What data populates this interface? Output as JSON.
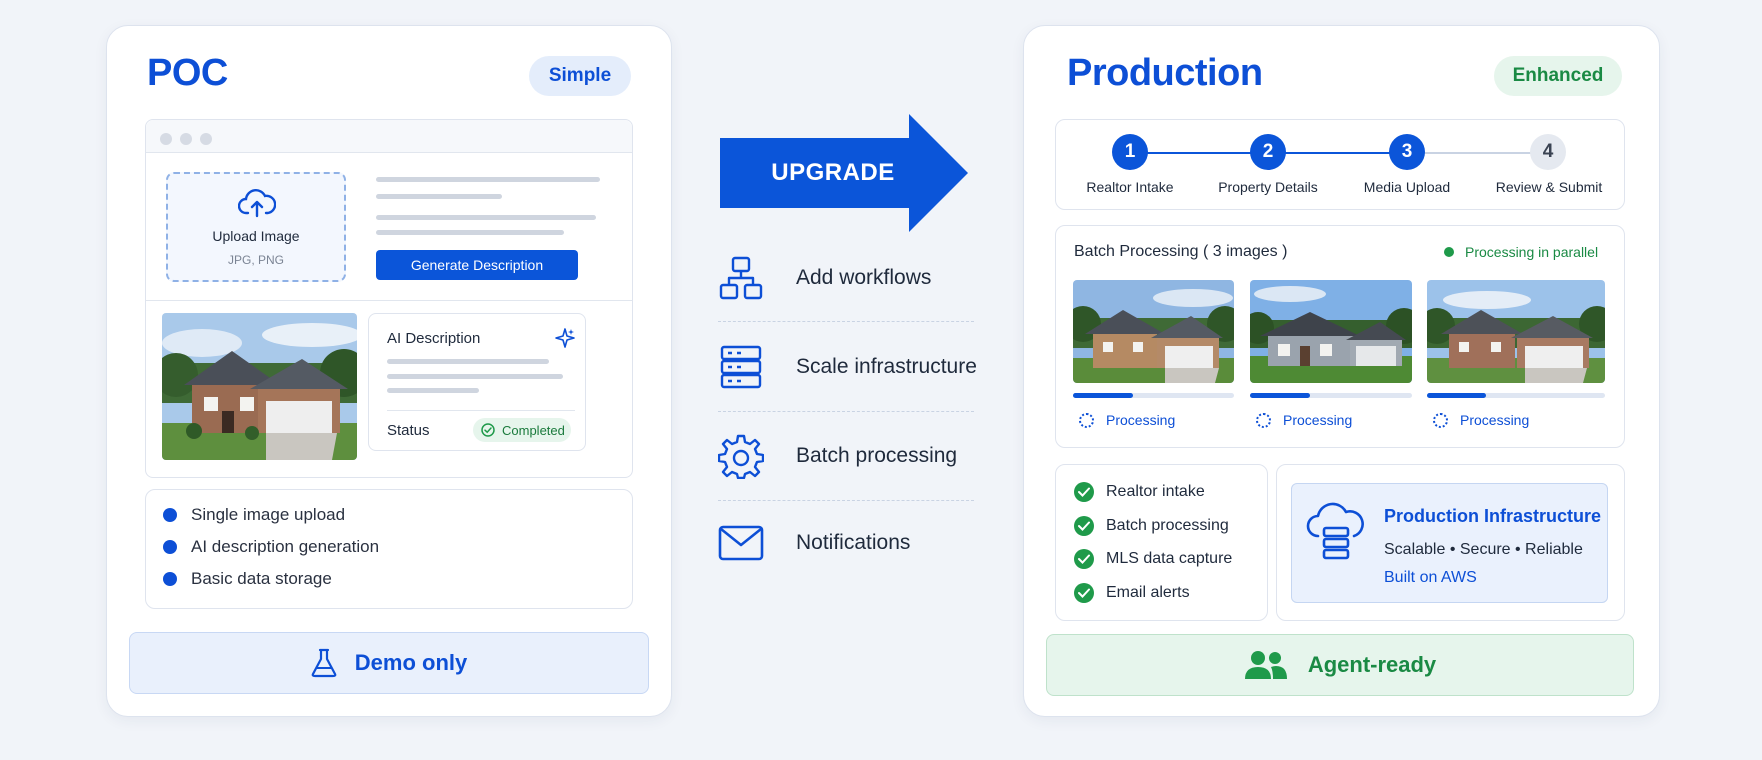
{
  "poc": {
    "title": "POC",
    "badge": "Simple",
    "upload_label": "Upload Image",
    "upload_formats": "JPG, PNG",
    "generate_button": "Generate Description",
    "ai_description_title": "AI Description",
    "status_label": "Status",
    "status_value": "Completed",
    "features": [
      "Single image upload",
      "AI description generation",
      "Basic data storage"
    ],
    "footer": "Demo only"
  },
  "upgrade": {
    "arrow_label": "UPGRADE",
    "items": [
      {
        "label": "Add workflows",
        "icon": "workflow-icon"
      },
      {
        "label": "Scale infrastructure",
        "icon": "server-icon"
      },
      {
        "label": "Batch processing",
        "icon": "gear-icon"
      },
      {
        "label": "Notifications",
        "icon": "mail-icon"
      }
    ]
  },
  "production": {
    "title": "Production",
    "badge": "Enhanced",
    "steps": [
      {
        "number": "1",
        "label": "Realtor Intake"
      },
      {
        "number": "2",
        "label": "Property Details"
      },
      {
        "number": "3",
        "label": "Media Upload"
      },
      {
        "number": "4",
        "label": "Review & Submit"
      }
    ],
    "batch_title": "Batch Processing ( 3 images )",
    "batch_status": "Processing in parallel",
    "images": [
      {
        "status": "Processing",
        "progress": 0.37
      },
      {
        "status": "Processing",
        "progress": 0.37
      },
      {
        "status": "Processing",
        "progress": 0.33
      }
    ],
    "checklist": [
      "Realtor intake",
      "Batch processing",
      "MLS data capture",
      "Email alerts"
    ],
    "infra_title": "Production Infrastructure",
    "infra_subtitle": "Scalable • Secure • Reliable",
    "infra_note": "Built on AWS",
    "footer": "Agent-ready"
  },
  "colors": {
    "primary": "#0b55d9",
    "success": "#1f9a4a",
    "success_bg": "#e6f5ec",
    "info_bg": "#e9f0fc"
  }
}
